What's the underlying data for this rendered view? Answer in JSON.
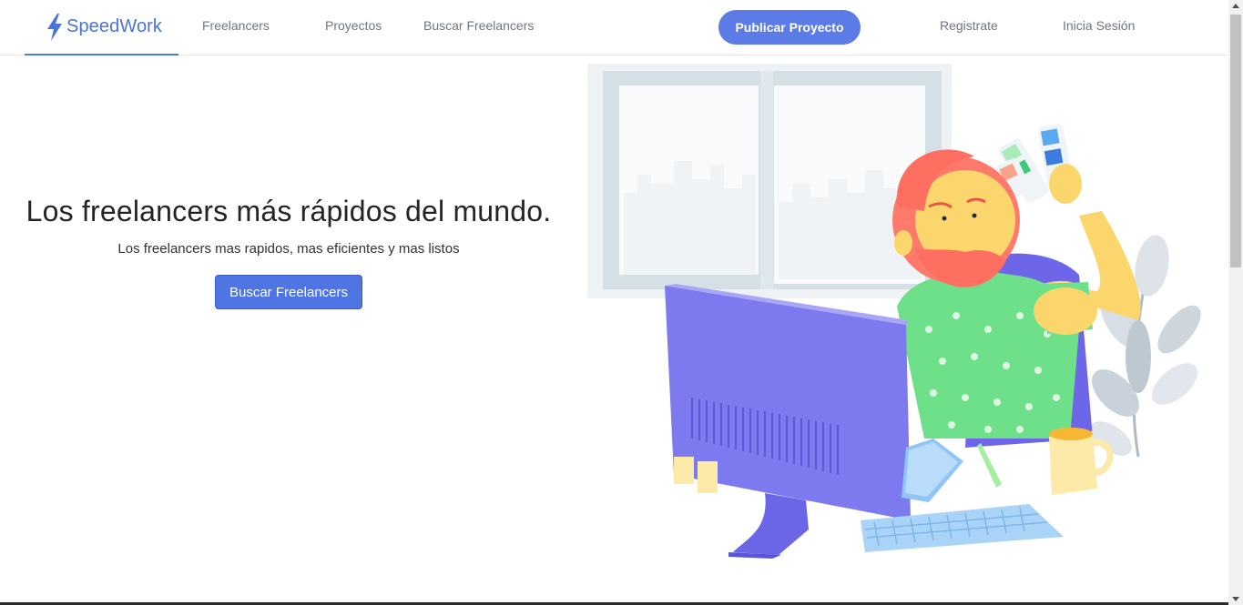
{
  "brand": {
    "name": "SpeedWork",
    "icon": "lightning-bolt-icon"
  },
  "nav": {
    "freelancers": "Freelancers",
    "proyectos": "Proyectos",
    "buscar_freelancers": "Buscar Freelancers",
    "publicar_proyecto": "Publicar Proyecto",
    "registrate": "Registrate",
    "inicia_sesion": "Inicia Sesión"
  },
  "hero": {
    "title": "Los freelancers más rápidos del mundo.",
    "subtitle": "Los freelancers mas rapidos, mas eficientes y mas listos",
    "cta": "Buscar Freelancers"
  },
  "colors": {
    "brand": "#4a74d9",
    "primary_button": "#5b7be6",
    "cta_button": "#4f74e3"
  }
}
